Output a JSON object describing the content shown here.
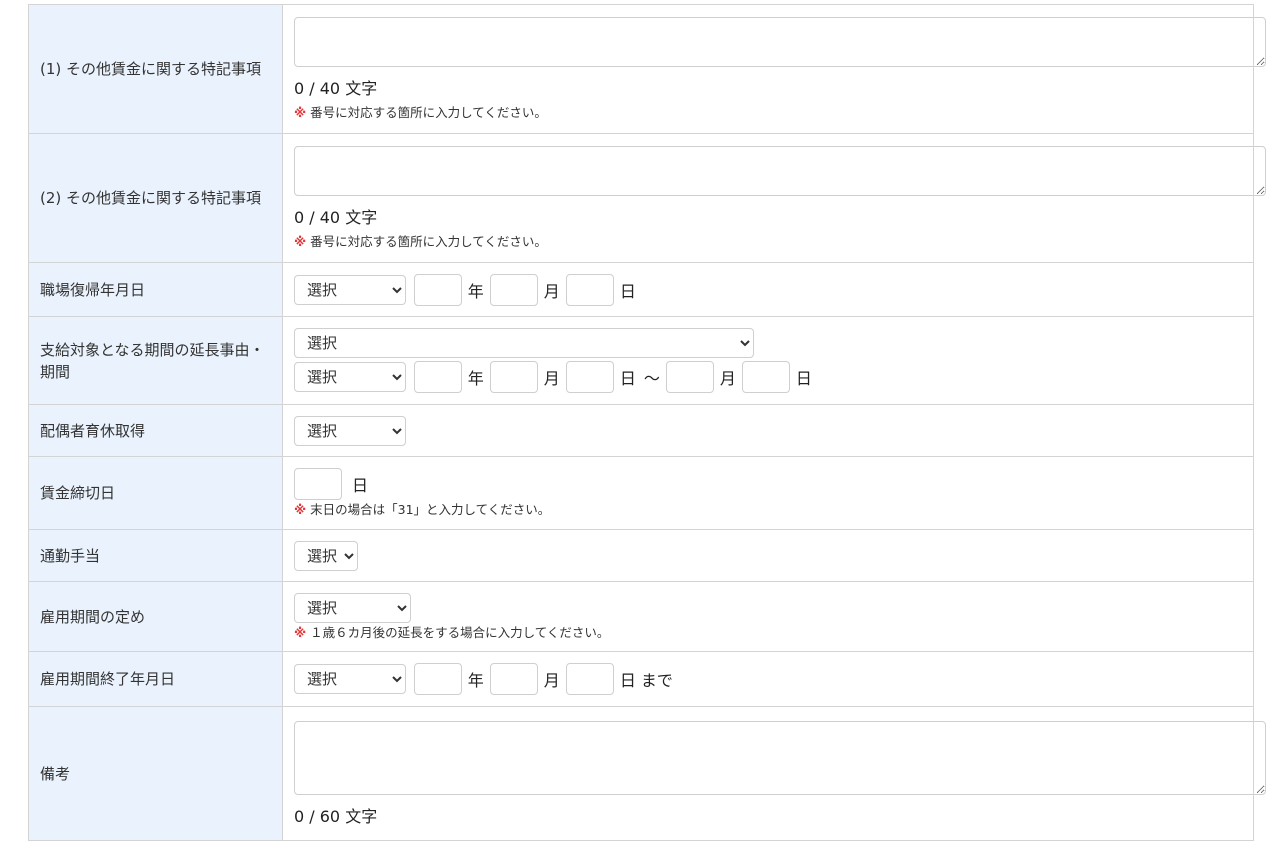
{
  "rows": {
    "special1": {
      "label": "(1) その他賃金に関する特記事項",
      "count": "0 / 40 文字",
      "note_mark": "※",
      "note": "番号に対応する箇所に入力してください。"
    },
    "special2": {
      "label": "(2) その他賃金に関する特記事項",
      "count": "0 / 40 文字",
      "note_mark": "※",
      "note": "番号に対応する箇所に入力してください。"
    },
    "return_date": {
      "label": "職場復帰年月日",
      "era_select": "選択",
      "year_unit": "年",
      "month_unit": "月",
      "day_unit": "日"
    },
    "extension": {
      "label": "支給対象となる期間の延長事由・期間",
      "reason_select": "選択",
      "era_select": "選択",
      "year_unit": "年",
      "month_unit": "月",
      "day_unit": "日",
      "tilde": "～",
      "month_unit2": "月",
      "day_unit2": "日"
    },
    "spouse_leave": {
      "label": "配偶者育休取得",
      "select": "選択"
    },
    "wage_cutoff": {
      "label": "賃金締切日",
      "day_unit": "日",
      "note_mark": "※",
      "note": "末日の場合は「31」と入力してください。"
    },
    "commute": {
      "label": "通勤手当",
      "select": "選択"
    },
    "employment_term": {
      "label": "雇用期間の定め",
      "select": "選択",
      "note_mark": "※",
      "note": "１歳６カ月後の延長をする場合に入力してください。"
    },
    "employment_end": {
      "label": "雇用期間終了年月日",
      "era_select": "選択",
      "year_unit": "年",
      "month_unit": "月",
      "day_unit": "日 まで"
    },
    "remarks": {
      "label": "備考",
      "count": "0 / 60 文字"
    }
  }
}
